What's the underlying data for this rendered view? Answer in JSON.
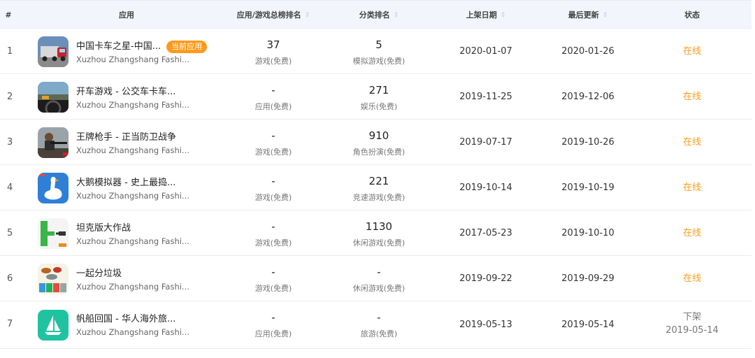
{
  "headers": {
    "index": "#",
    "app": "应用",
    "total_rank": "应用/游戏总榜排名",
    "category_rank": "分类排名",
    "release_date": "上架日期",
    "last_update": "最后更新",
    "status": "状态"
  },
  "sort_glyph": "⇕",
  "rows": [
    {
      "idx": "1",
      "name": "中国卡车之星-中国...",
      "badge": "当前应用",
      "dev": "Xuzhou Zhangshang Fashi...",
      "total_rank": "37",
      "total_type": "游戏(免费)",
      "cat_rank": "5",
      "cat_type": "模拟游戏(免费)",
      "release": "2020-01-07",
      "update": "2020-01-26",
      "status": "在线",
      "icon": "truck-game-icon"
    },
    {
      "idx": "2",
      "name": "开车游戏 - 公交车卡车...",
      "dev": "Xuzhou Zhangshang Fashi...",
      "total_rank": "-",
      "total_type": "应用(免费)",
      "cat_rank": "271",
      "cat_type": "娱乐(免费)",
      "release": "2019-11-25",
      "update": "2019-12-06",
      "status": "在线",
      "icon": "driving-game-icon"
    },
    {
      "idx": "3",
      "name": "王牌枪手 - 正当防卫战争",
      "dev": "Xuzhou Zhangshang Fashi...",
      "total_rank": "-",
      "total_type": "游戏(免费)",
      "cat_rank": "910",
      "cat_type": "角色扮演(免费)",
      "release": "2019-07-17",
      "update": "2019-10-26",
      "status": "在线",
      "icon": "sniper-game-icon"
    },
    {
      "idx": "4",
      "name": "大鹅模拟器 - 史上最捣...",
      "dev": "Xuzhou Zhangshang Fashi...",
      "total_rank": "-",
      "total_type": "游戏(免费)",
      "cat_rank": "221",
      "cat_type": "竞速游戏(免费)",
      "release": "2019-10-14",
      "update": "2019-10-19",
      "status": "在线",
      "icon": "goose-game-icon"
    },
    {
      "idx": "5",
      "name": "坦克版大作战",
      "dev": "Xuzhou Zhangshang Fashi...",
      "total_rank": "-",
      "total_type": "游戏(免费)",
      "cat_rank": "1130",
      "cat_type": "休闲游戏(免费)",
      "release": "2017-05-23",
      "update": "2019-10-10",
      "status": "在线",
      "icon": "tank-game-icon"
    },
    {
      "idx": "6",
      "name": "一起分垃圾",
      "dev": "Xuzhou Zhangshang Fashi...",
      "total_rank": "-",
      "total_type": "游戏(免费)",
      "cat_rank": "-",
      "cat_type": "休闲游戏(免费)",
      "release": "2019-09-22",
      "update": "2019-09-29",
      "status": "在线",
      "icon": "garbage-sort-game-icon"
    },
    {
      "idx": "7",
      "name": "帆船回国 - 华人海外旅...",
      "dev": "Xuzhou Zhangshang Fashi...",
      "total_rank": "-",
      "total_type": "应用(免费)",
      "cat_rank": "-",
      "cat_type": "旅游(免费)",
      "release": "2019-05-13",
      "update": "2019-05-14",
      "status": "下架",
      "status_date": "2019-05-14",
      "icon": "sailboat-app-icon"
    }
  ],
  "colors": {
    "online": "#ff9a1a",
    "header_bg": "#f2f5fb"
  }
}
